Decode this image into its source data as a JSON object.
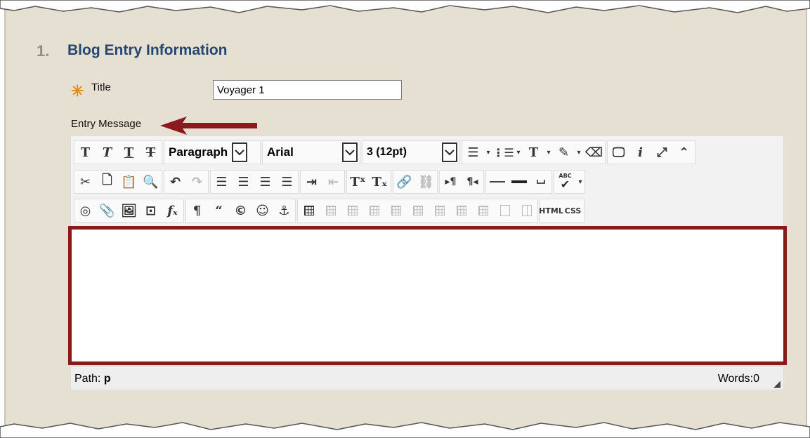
{
  "section": {
    "number": "1.",
    "title": "Blog Entry Information"
  },
  "title_field": {
    "required_icon": "asterisk-icon",
    "label": "Title",
    "value": "Voyager 1"
  },
  "entry": {
    "label": "Entry Message"
  },
  "toolbar": {
    "format_select": "Paragraph",
    "font_select": "Arial",
    "size_select": "3 (12pt)",
    "row1_icons": [
      "bold-icon",
      "italic-icon",
      "underline-icon",
      "strikethrough-icon",
      "bullet-list-icon",
      "numbered-list-icon",
      "text-color-icon",
      "highlight-icon",
      "eraser-icon",
      "preview-icon",
      "info-icon",
      "fullscreen-icon",
      "collapse-icon"
    ],
    "row2_icons": [
      "cut-icon",
      "copy-icon",
      "paste-icon",
      "find-icon",
      "undo-icon",
      "redo-icon",
      "align-left-icon",
      "align-center-icon",
      "align-right-icon",
      "justify-icon",
      "indent-icon",
      "outdent-icon",
      "superscript-icon",
      "subscript-icon",
      "link-icon",
      "unlink-icon",
      "ltr-icon",
      "rtl-icon",
      "horizontal-rule-icon",
      "thick-rule-icon",
      "nonbreaking-space-icon",
      "spellcheck-icon"
    ],
    "row3_icons": [
      "mashup-icon",
      "attach-icon",
      "image-icon",
      "media-icon",
      "math-icon",
      "pilcrow-icon",
      "blockquote-icon",
      "copyright-icon",
      "emoticon-icon",
      "anchor-icon",
      "table-icon",
      "html-icon",
      "css-icon"
    ],
    "html_label": "HTML",
    "css_label": "CSS",
    "spell_label": "ABC"
  },
  "status": {
    "path_label": "Path:",
    "path_value": "p",
    "words": "Words:0"
  },
  "colors": {
    "paper": "#e6e0d2",
    "heading": "#24466f",
    "highlight_border": "#8b1a1e",
    "required_star": "#e48a13"
  }
}
